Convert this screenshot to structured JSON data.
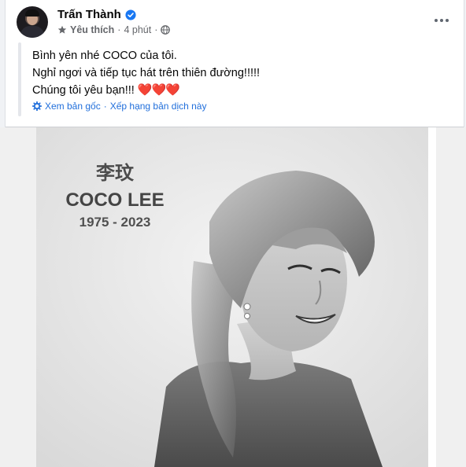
{
  "post": {
    "author": "Trấn Thành",
    "audience_label": "Yêu thích",
    "time": "4 phút",
    "lines": [
      "Bình yên nhé COCO của tôi.",
      "Nghỉ ngơi và tiếp tục hát trên thiên đường!!!!!",
      "Chúng tôi yêu bạn!!!"
    ],
    "hearts": "❤️❤️❤️",
    "see_original": "Xem bản gốc",
    "separator": "·",
    "rate_translation": "Xếp hạng bản dịch này"
  },
  "photo": {
    "chinese_name": "李玟",
    "name": "COCO LEE",
    "years": "1975 - 2023"
  },
  "icons": {
    "verified": "verified-badge-icon",
    "star": "star-icon",
    "globe": "globe-icon",
    "more": "more-options-icon",
    "translate": "translate-gear-icon"
  },
  "colors": {
    "verified_blue": "#1877f2",
    "link_blue": "#216fdb",
    "heart_red": "#e41e3f"
  }
}
